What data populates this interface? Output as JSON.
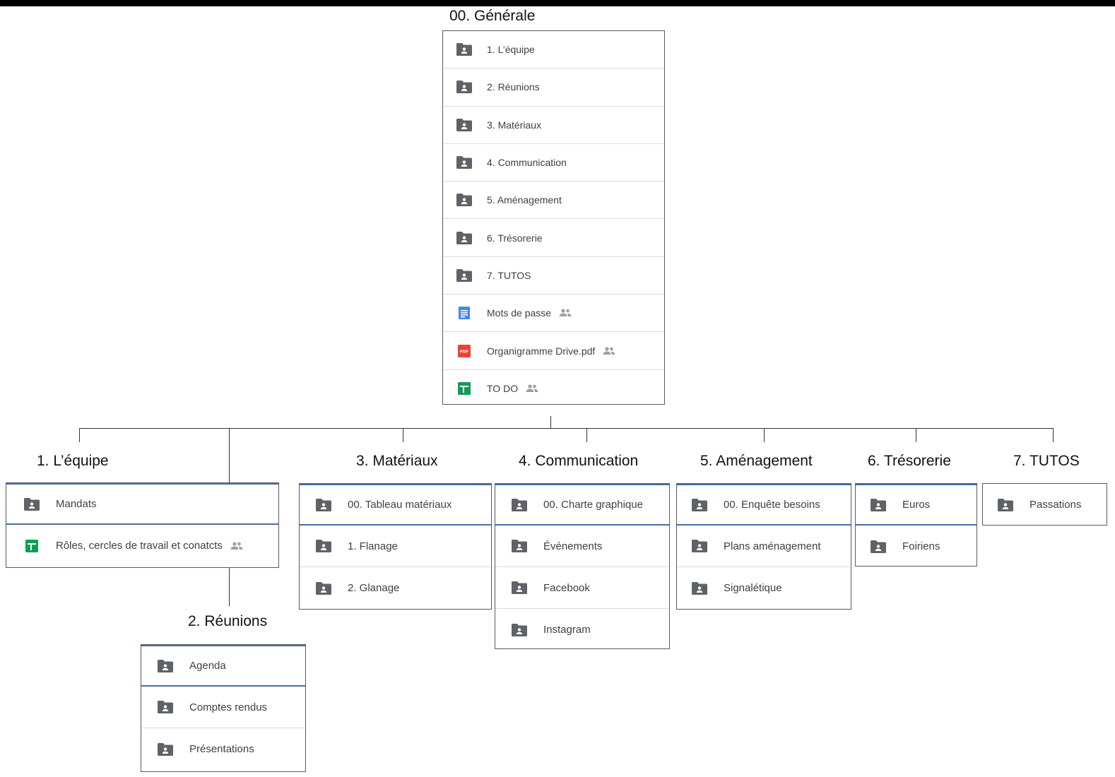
{
  "root": {
    "title": "00. Générale",
    "items": [
      {
        "label": "1. L’équipe",
        "icon": "folder-shared-icon"
      },
      {
        "label": "2. Réunions",
        "icon": "folder-shared-icon"
      },
      {
        "label": "3. Matériaux",
        "icon": "folder-shared-icon"
      },
      {
        "label": "4. Communication",
        "icon": "folder-shared-icon"
      },
      {
        "label": "5. Aménagement",
        "icon": "folder-shared-icon"
      },
      {
        "label": "6. Trésorerie",
        "icon": "folder-shared-icon"
      },
      {
        "label": "7. TUTOS",
        "icon": "folder-shared-icon"
      },
      {
        "label": "Mots de passe",
        "icon": "docs-icon",
        "shared": true
      },
      {
        "label": "Organigramme Drive.pdf",
        "icon": "pdf-icon",
        "shared": true
      },
      {
        "label": "TO DO",
        "icon": "sheets-icon",
        "shared": true
      }
    ]
  },
  "folders": {
    "equipe": {
      "title": "1. L’équipe",
      "items": [
        {
          "label": "Mandats",
          "icon": "folder-shared-icon"
        },
        {
          "label": "Rôles, cercles de travail et conatcts",
          "icon": "sheets-icon",
          "shared": true
        }
      ]
    },
    "reunions": {
      "title": "2. Réunions",
      "items": [
        {
          "label": "Agenda",
          "icon": "folder-shared-icon"
        },
        {
          "label": "Comptes rendus",
          "icon": "folder-shared-icon"
        },
        {
          "label": "Présentations",
          "icon": "folder-shared-icon"
        }
      ]
    },
    "materiaux": {
      "title": "3. Matériaux",
      "items": [
        {
          "label": "00. Tableau matériaux",
          "icon": "folder-shared-icon"
        },
        {
          "label": "1. Flanage",
          "icon": "folder-shared-icon"
        },
        {
          "label": "2. Glanage",
          "icon": "folder-shared-icon"
        }
      ]
    },
    "communication": {
      "title": "4. Communication",
      "items": [
        {
          "label": "00. Charte graphique",
          "icon": "folder-shared-icon"
        },
        {
          "label": "Événements",
          "icon": "folder-shared-icon"
        },
        {
          "label": "Facebook",
          "icon": "folder-shared-icon"
        },
        {
          "label": "Instagram",
          "icon": "folder-shared-icon"
        }
      ]
    },
    "amenagement": {
      "title": "5. Aménagement",
      "items": [
        {
          "label": "00. Enquête besoins",
          "icon": "folder-shared-icon"
        },
        {
          "label": "Plans aménagement",
          "icon": "folder-shared-icon"
        },
        {
          "label": "Signalétique",
          "icon": "folder-shared-icon"
        }
      ]
    },
    "tresorerie": {
      "title": "6. Trésorerie",
      "items": [
        {
          "label": "Euros",
          "icon": "folder-shared-icon"
        },
        {
          "label": "Foiriens",
          "icon": "folder-shared-icon"
        }
      ]
    },
    "tutos": {
      "title": "7. TUTOS",
      "items": [
        {
          "label": "Passations",
          "icon": "folder-shared-icon"
        }
      ]
    }
  },
  "colors": {
    "folder": "#5f6368",
    "docs": "#4285f4",
    "pdf": "#ea4335",
    "sheets": "#0f9d58",
    "selected_border": "#4a6fa5"
  }
}
